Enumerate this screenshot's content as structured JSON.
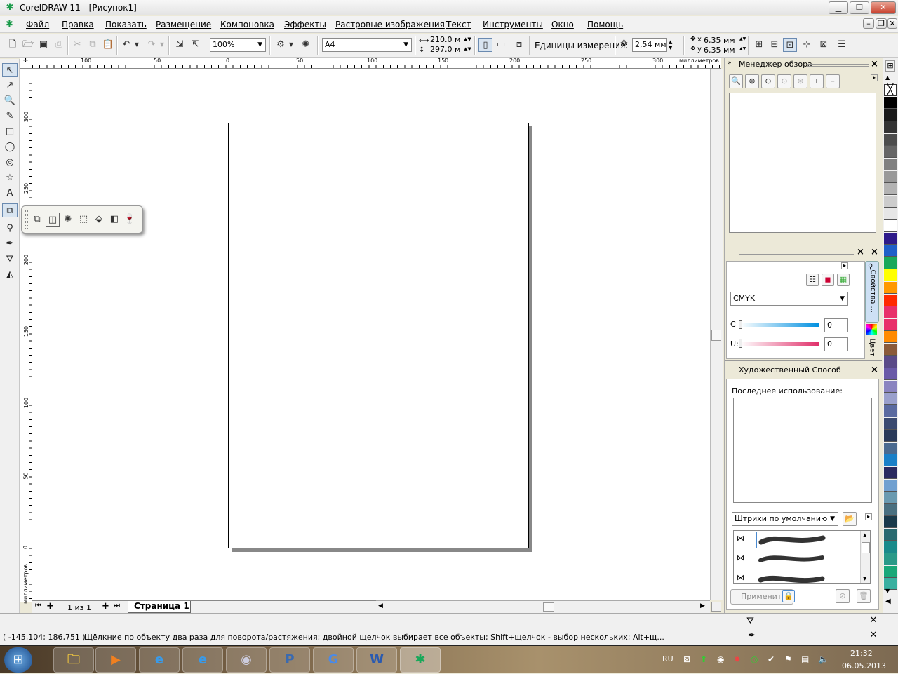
{
  "window": {
    "title": "CorelDRAW 11 - [Рисунок1]",
    "app_glyph": "✱"
  },
  "menu": [
    "Файл",
    "Правка",
    "Показать",
    "Размещение",
    "Компоновка",
    "Эффекты",
    "Растровые изображения",
    "Текст",
    "Инструменты",
    "Окно",
    "Помощь"
  ],
  "toolbar": {
    "zoom": "100%",
    "paper": "A4",
    "width": "210.0 м",
    "height": "297.0 м",
    "units_label": "Единицы измерения:",
    "nudge": "2,54 мм",
    "dup_x": "6,35 мм",
    "dup_y": "6,35 мм",
    "dup_x_label": "x",
    "dup_y_label": "y"
  },
  "rulers": {
    "h_ticks": [
      "100",
      "50",
      "0",
      "50",
      "100",
      "150",
      "200",
      "250",
      "300"
    ],
    "h_unit": "миллиметров",
    "v_ticks": [
      "300",
      "250",
      "200",
      "150",
      "100",
      "50",
      "0"
    ],
    "v_unit": "миллиметров"
  },
  "pagetabs": {
    "counter": "1 из 1",
    "page_label": "Страница 1"
  },
  "docker_view": {
    "title": "Менеджер обзора"
  },
  "docker_color": {
    "model": "CMYK",
    "c_label": "C",
    "c_value": "0",
    "u_label": "U:",
    "u_value": "0",
    "tab_props": "Свойства ...",
    "tab_color": "Цвет"
  },
  "docker_artistic": {
    "title": "Художественный Способ",
    "recent_label": "Последнее использование:",
    "preset": "Штрихи по умолчанию",
    "apply": "Применить"
  },
  "palette_colors": [
    "#000000",
    "#1a1a1a",
    "#333333",
    "#4d4d4d",
    "#666666",
    "#808080",
    "#999999",
    "#b3b3b3",
    "#cccccc",
    "#e6e6e6",
    "#ffffff",
    "#2e1a8a",
    "#1f5fc8",
    "#1aa85a",
    "#ffff00",
    "#ff9900",
    "#ff2a00",
    "#e8306a",
    "#e8306a",
    "#ff8a00",
    "#8a5a3a",
    "#5a4a88",
    "#6a5aa8",
    "#8a84c0",
    "#9aa0cc",
    "#5a6aa0",
    "#3a4a70",
    "#2a3a5a",
    "#4a6a90",
    "#1a80c8",
    "#2a2a60",
    "#70a0d0",
    "#6a9ab0",
    "#4a7080",
    "#1a3a4a",
    "#2a6a70",
    "#1a8a8a",
    "#2a9a88",
    "#1aa878",
    "#3ab0a0"
  ],
  "status": {
    "coords": "( -145,104; 186,751 )",
    "message": "Щёлкние по объекту два раза для поворота/растяжения; двойной щелчок выбирает все объекты; Shift+щелчок - выбор нескольких; Alt+щ..."
  },
  "taskbar": {
    "lang": "RU",
    "time": "21:32",
    "date": "06.05.2013"
  }
}
